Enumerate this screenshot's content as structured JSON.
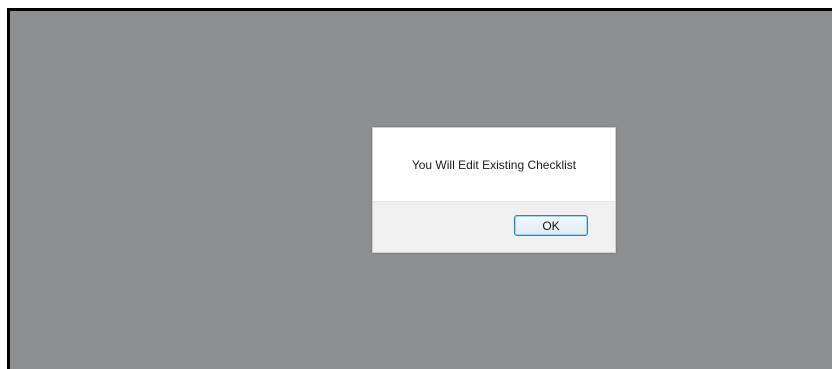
{
  "dialog": {
    "message": "You Will Edit Existing Checklist",
    "ok_label": "OK"
  },
  "colors": {
    "overlay": "#8e8f90",
    "dialog_background": "#ffffff",
    "footer_background": "#f0f0f0",
    "button_border": "#3c7fb1"
  }
}
